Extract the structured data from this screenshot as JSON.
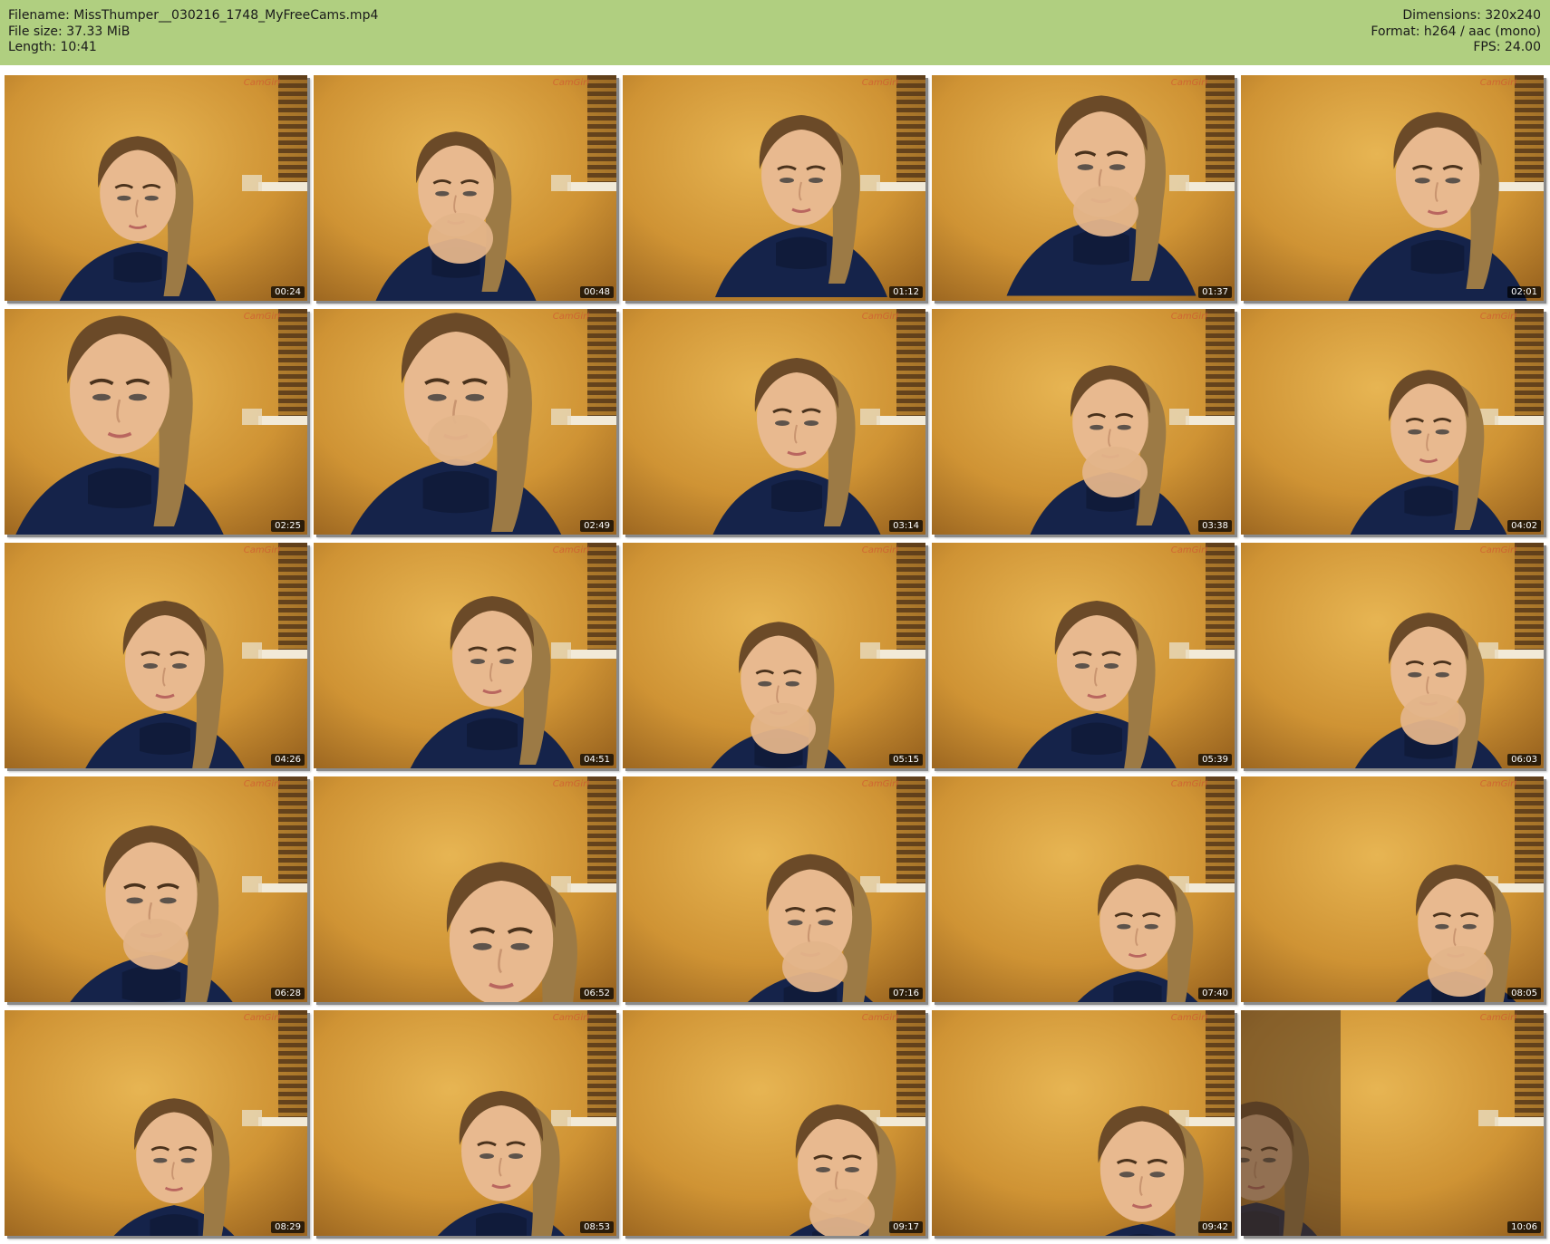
{
  "header": {
    "filename_line": "Filename: MissThumper__030216_1748_MyFreeCams.mp4",
    "filesize_line": "File size: 37.33 MiB",
    "length_line": "Length: 10:41",
    "dimensions_line": "Dimensions: 320x240",
    "format_line": "Format: h264 / aac (mono)",
    "fps_line": "FPS: 24.00",
    "background_color": "#b0cf80"
  },
  "thumbnails": [
    {
      "timestamp": "00:24"
    },
    {
      "timestamp": "00:48"
    },
    {
      "timestamp": "01:12"
    },
    {
      "timestamp": "01:37"
    },
    {
      "timestamp": "02:01"
    },
    {
      "timestamp": "02:25"
    },
    {
      "timestamp": "02:49"
    },
    {
      "timestamp": "03:14"
    },
    {
      "timestamp": "03:38"
    },
    {
      "timestamp": "04:02"
    },
    {
      "timestamp": "04:26"
    },
    {
      "timestamp": "04:51"
    },
    {
      "timestamp": "05:15"
    },
    {
      "timestamp": "05:39"
    },
    {
      "timestamp": "06:03"
    },
    {
      "timestamp": "06:28"
    },
    {
      "timestamp": "06:52"
    },
    {
      "timestamp": "07:16"
    },
    {
      "timestamp": "07:40"
    },
    {
      "timestamp": "08:05"
    },
    {
      "timestamp": "08:29"
    },
    {
      "timestamp": "08:53"
    },
    {
      "timestamp": "09:17"
    },
    {
      "timestamp": "09:42"
    },
    {
      "timestamp": "10:06"
    }
  ],
  "watermark": "CamGirl",
  "colors": {
    "wall": "#d39a3c",
    "sweater": "#15234a",
    "timestamp_bg": "#000000"
  }
}
